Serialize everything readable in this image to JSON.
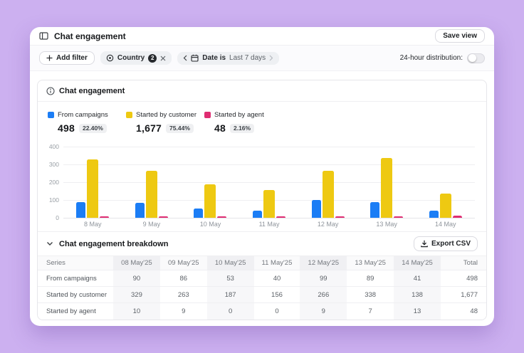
{
  "colors": {
    "background": "#ccb0f0",
    "campaigns": "#1b7df5",
    "customer": "#eec912",
    "agent": "#df2d72"
  },
  "window": {
    "title": "Chat engagement",
    "save_view_label": "Save view"
  },
  "filter_bar": {
    "add_filter_label": "Add filter",
    "country_chip": {
      "label": "Country",
      "count": "2"
    },
    "date_chip": {
      "prefix": "Date is",
      "value": "Last 7 days"
    },
    "distribution_toggle": {
      "label": "24-hour distribution:",
      "state": "off"
    }
  },
  "panel": {
    "title": "Chat engagement",
    "legend": [
      {
        "name": "From campaigns",
        "value": "498",
        "percent": "22.40%",
        "color": "#1b7df5"
      },
      {
        "name": "Started by customer",
        "value": "1,677",
        "percent": "75.44%",
        "color": "#eec912"
      },
      {
        "name": "Started by agent",
        "value": "48",
        "percent": "2.16%",
        "color": "#df2d72"
      }
    ]
  },
  "chart_data": {
    "type": "bar",
    "categories": [
      "8 May",
      "9 May",
      "10 May",
      "11 May",
      "12 May",
      "13 May",
      "14 May"
    ],
    "series": [
      {
        "name": "From campaigns",
        "color": "#1b7df5",
        "values": [
          90,
          86,
          53,
          40,
          99,
          89,
          41
        ]
      },
      {
        "name": "Started by customer",
        "color": "#eec912",
        "values": [
          329,
          263,
          187,
          156,
          266,
          338,
          138
        ]
      },
      {
        "name": "Started by agent",
        "color": "#df2d72",
        "values": [
          10,
          9,
          0,
          0,
          9,
          7,
          13
        ]
      }
    ],
    "title": "Chat engagement",
    "xlabel": "",
    "ylabel": "",
    "ylim": [
      0,
      400
    ],
    "yticks": [
      0,
      100,
      200,
      300,
      400
    ],
    "grid": true,
    "legend_position": "top"
  },
  "breakdown": {
    "title": "Chat engagement breakdown",
    "export_label": "Export CSV",
    "table": {
      "columns": [
        "Series",
        "08 May'25",
        "09 May'25",
        "10 May'25",
        "11 May'25",
        "12 May'25",
        "13 May'25",
        "14 May'25",
        "Total"
      ],
      "rows": [
        {
          "series": "From campaigns",
          "values": [
            "90",
            "86",
            "53",
            "40",
            "99",
            "89",
            "41"
          ],
          "total": "498"
        },
        {
          "series": "Started by customer",
          "values": [
            "329",
            "263",
            "187",
            "156",
            "266",
            "338",
            "138"
          ],
          "total": "1,677"
        },
        {
          "series": "Started by agent",
          "values": [
            "10",
            "9",
            "0",
            "0",
            "9",
            "7",
            "13"
          ],
          "total": "48"
        }
      ]
    }
  }
}
